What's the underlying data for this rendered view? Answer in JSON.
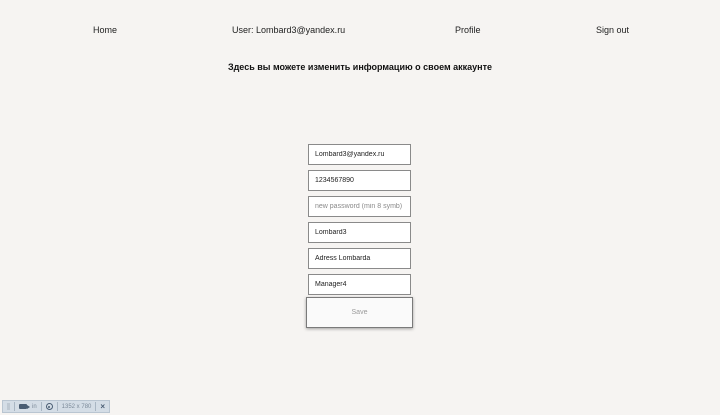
{
  "nav": {
    "home": "Home",
    "user": "User: Lombard3@yandex.ru",
    "profile": "Profile",
    "signout": "Sign out"
  },
  "page": {
    "heading": "Здесь вы можете изменить информацию о своем аккаунте"
  },
  "form": {
    "email": "Lombard3@yandex.ru",
    "phone": "1234567890",
    "password_placeholder": "new password (min 8 symb)",
    "name": "Lombard3",
    "address": "Adress Lombarda",
    "role": "Manager4",
    "save_label": "Save"
  },
  "devbar": {
    "units": "in",
    "resolution": "1352 x 780",
    "close": "×"
  },
  "colors": {
    "background": "#f6f4f2",
    "input_border": "#8a8a8a",
    "devbar_bg": "#d4dde6"
  },
  "icons": [
    "grip-icon",
    "camera-icon",
    "eye-icon",
    "close-icon"
  ]
}
